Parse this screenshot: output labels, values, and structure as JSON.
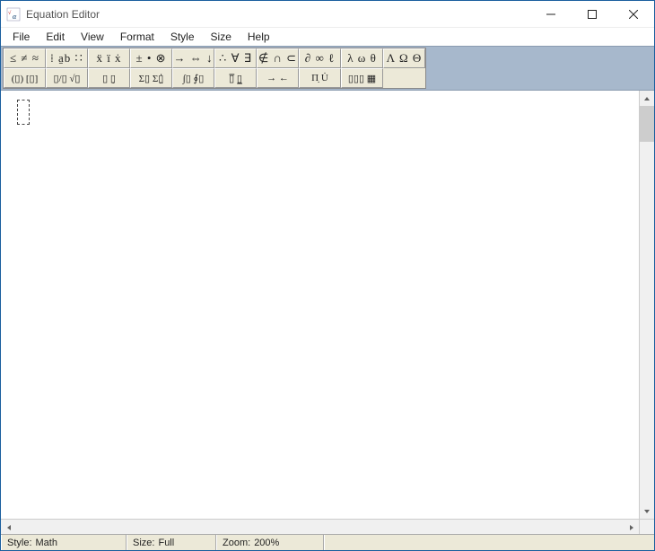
{
  "window": {
    "title": "Equation Editor"
  },
  "menu": {
    "items": [
      "File",
      "Edit",
      "View",
      "Format",
      "Style",
      "Size",
      "Help"
    ]
  },
  "toolbar": {
    "row1": [
      {
        "name": "relational-symbols",
        "glyph": "≤ ≠ ≈"
      },
      {
        "name": "spaces-ellipses",
        "glyph": "⁞ a̱b ∷"
      },
      {
        "name": "embellishments",
        "glyph": "ẍ ï ẋ"
      },
      {
        "name": "operator-symbols",
        "glyph": "± • ⊗"
      },
      {
        "name": "arrow-symbols",
        "glyph": "→ ⇔ ↓"
      },
      {
        "name": "logical-symbols",
        "glyph": "∴ ∀ ∃"
      },
      {
        "name": "set-theory-symbols",
        "glyph": "∉ ∩ ⊂"
      },
      {
        "name": "misc-symbols",
        "glyph": "∂ ∞ ℓ"
      },
      {
        "name": "greek-lowercase",
        "glyph": "λ ω θ"
      },
      {
        "name": "greek-uppercase",
        "glyph": "Λ Ω Θ"
      }
    ],
    "row2": [
      {
        "name": "fence-templates",
        "glyph": "(▯) [▯]"
      },
      {
        "name": "fraction-radical-templates",
        "glyph": "▯/▯ √▯"
      },
      {
        "name": "subscript-superscript-templates",
        "glyph": "▯  ▯̣"
      },
      {
        "name": "summation-templates",
        "glyph": "Σ▯ Σ▯̤̇"
      },
      {
        "name": "integral-templates",
        "glyph": "∫▯ ∮▯"
      },
      {
        "name": "underbar-overbar-templates",
        "glyph": "▯̅ ▯̲"
      },
      {
        "name": "labeled-arrow-templates",
        "glyph": "→ ←"
      },
      {
        "name": "products-set-templates",
        "glyph": "Π̣ U̇"
      },
      {
        "name": "matrix-templates",
        "glyph": "▯▯▯ ▦"
      }
    ]
  },
  "status": {
    "style_label": "Style:",
    "style_value": "Math",
    "size_label": "Size:",
    "size_value": "Full",
    "zoom_label": "Zoom:",
    "zoom_value": "200%"
  }
}
